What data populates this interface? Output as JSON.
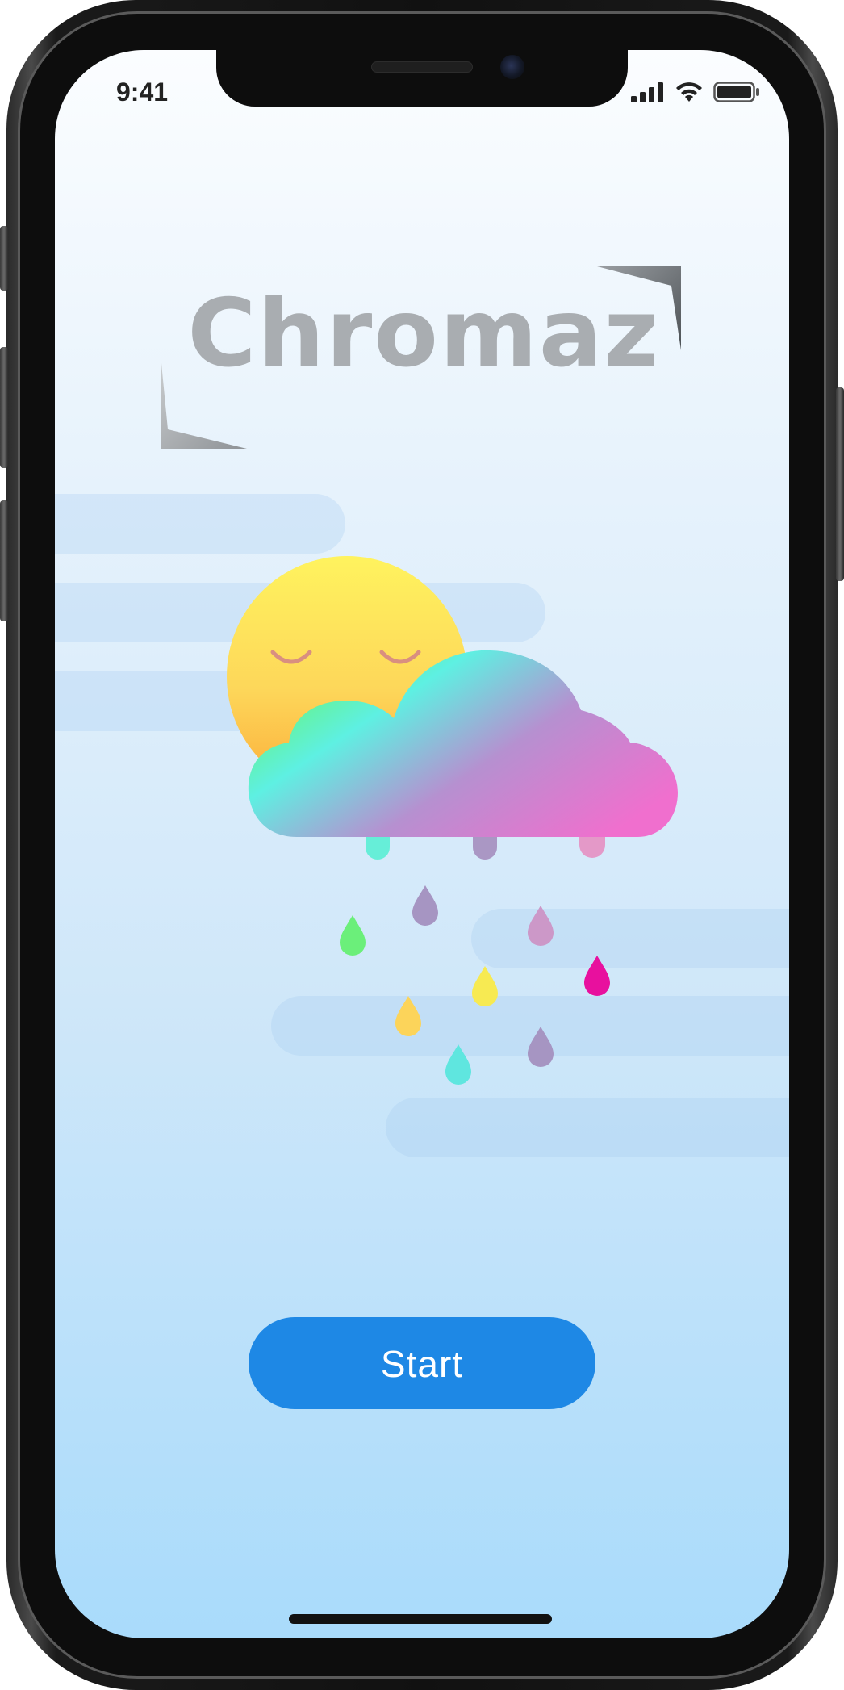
{
  "status_bar": {
    "time": "9:41",
    "signal_icon": "cellular-signal-icon",
    "wifi_icon": "wifi-icon",
    "battery_icon": "battery-icon"
  },
  "app": {
    "logo_text": "Chromaz",
    "start_label": "Start"
  },
  "illustration": {
    "subject": "sleepy-sun-behind-rainbow-cloud-with-rain",
    "drop_colors": [
      "#6bef7a",
      "#a695c2",
      "#cc98c8",
      "#e8109e",
      "#f7ea52",
      "#fcd45a",
      "#5fe6df",
      "#a695c2"
    ]
  },
  "colors": {
    "accent": "#1e88e5",
    "logo_gray": "#a9adb1",
    "background_top": "#fbfdff",
    "background_bottom": "#a9dbfb"
  }
}
